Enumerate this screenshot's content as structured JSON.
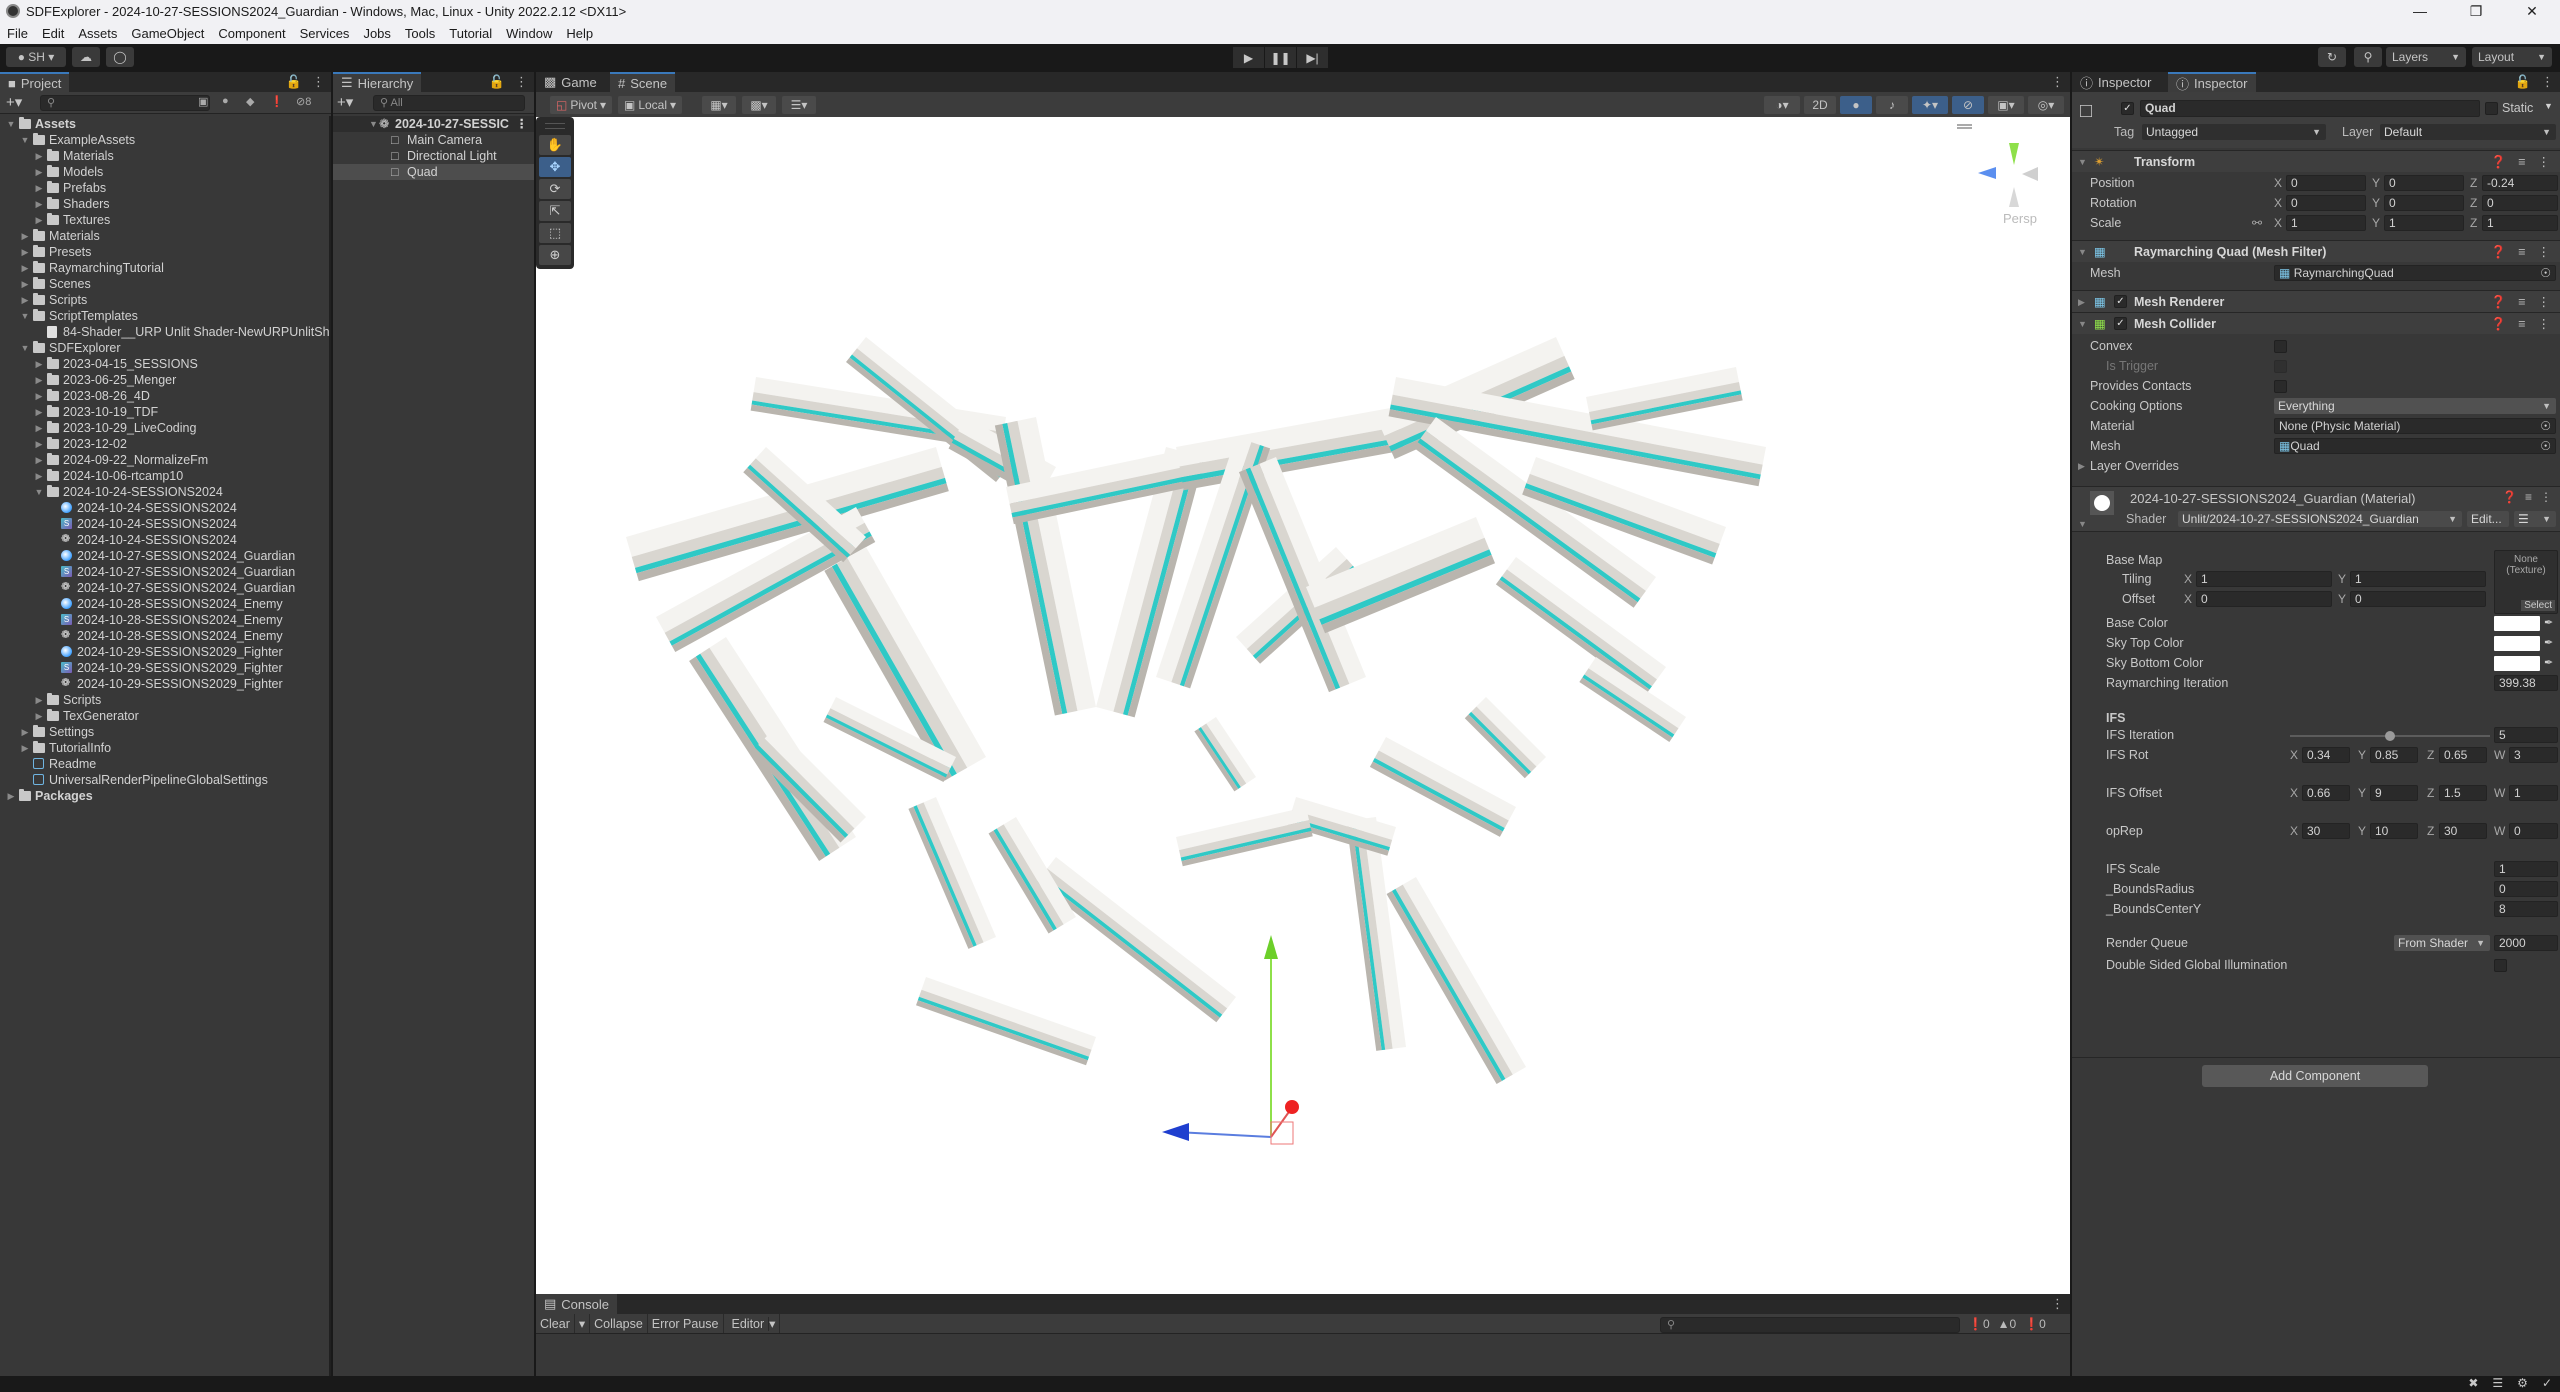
{
  "window": {
    "title": "SDFExplorer - 2024-10-27-SESSIONS2024_Guardian - Windows, Mac, Linux - Unity 2022.2.12 <DX11>",
    "controls": [
      "minimize",
      "maximize",
      "close"
    ]
  },
  "menu": [
    "File",
    "Edit",
    "Assets",
    "GameObject",
    "Component",
    "Services",
    "Jobs",
    "Tools",
    "Tutorial",
    "Window",
    "Help"
  ],
  "toolbar": {
    "account": "SH",
    "layers": "Layers",
    "layout": "Layout"
  },
  "project": {
    "tab": "Project",
    "hidden_count": "8",
    "tree": [
      {
        "label": "Assets",
        "depth": 0,
        "type": "folder-open",
        "expanded": true,
        "bold": true
      },
      {
        "label": "ExampleAssets",
        "depth": 1,
        "type": "folder-open",
        "expanded": true
      },
      {
        "label": "Materials",
        "depth": 2,
        "type": "folder"
      },
      {
        "label": "Models",
        "depth": 2,
        "type": "folder"
      },
      {
        "label": "Prefabs",
        "depth": 2,
        "type": "folder"
      },
      {
        "label": "Shaders",
        "depth": 2,
        "type": "folder"
      },
      {
        "label": "Textures",
        "depth": 2,
        "type": "folder"
      },
      {
        "label": "Materials",
        "depth": 1,
        "type": "folder"
      },
      {
        "label": "Presets",
        "depth": 1,
        "type": "folder"
      },
      {
        "label": "RaymarchingTutorial",
        "depth": 1,
        "type": "folder"
      },
      {
        "label": "Scenes",
        "depth": 1,
        "type": "folder"
      },
      {
        "label": "Scripts",
        "depth": 1,
        "type": "folder"
      },
      {
        "label": "ScriptTemplates",
        "depth": 1,
        "type": "folder-open",
        "expanded": true
      },
      {
        "label": "84-Shader__URP Unlit Shader-NewURPUnlitSh",
        "depth": 2,
        "type": "doc"
      },
      {
        "label": "SDFExplorer",
        "depth": 1,
        "type": "folder-open",
        "expanded": true
      },
      {
        "label": "2023-04-15_SESSIONS",
        "depth": 2,
        "type": "folder"
      },
      {
        "label": "2023-06-25_Menger",
        "depth": 2,
        "type": "folder"
      },
      {
        "label": "2023-08-26_4D",
        "depth": 2,
        "type": "folder"
      },
      {
        "label": "2023-10-19_TDF",
        "depth": 2,
        "type": "folder"
      },
      {
        "label": "2023-10-29_LiveCoding",
        "depth": 2,
        "type": "folder"
      },
      {
        "label": "2023-12-02",
        "depth": 2,
        "type": "folder"
      },
      {
        "label": "2024-09-22_NormalizeFm",
        "depth": 2,
        "type": "folder"
      },
      {
        "label": "2024-10-06-rtcamp10",
        "depth": 2,
        "type": "folder"
      },
      {
        "label": "2024-10-24-SESSIONS2024",
        "depth": 2,
        "type": "folder-open",
        "expanded": true
      },
      {
        "label": "2024-10-24-SESSIONS2024",
        "depth": 3,
        "type": "material"
      },
      {
        "label": "2024-10-24-SESSIONS2024",
        "depth": 3,
        "type": "shader"
      },
      {
        "label": "2024-10-24-SESSIONS2024",
        "depth": 3,
        "type": "scene"
      },
      {
        "label": "2024-10-27-SESSIONS2024_Guardian",
        "depth": 3,
        "type": "material"
      },
      {
        "label": "2024-10-27-SESSIONS2024_Guardian",
        "depth": 3,
        "type": "shader"
      },
      {
        "label": "2024-10-27-SESSIONS2024_Guardian",
        "depth": 3,
        "type": "scene"
      },
      {
        "label": "2024-10-28-SESSIONS2024_Enemy",
        "depth": 3,
        "type": "material"
      },
      {
        "label": "2024-10-28-SESSIONS2024_Enemy",
        "depth": 3,
        "type": "shader"
      },
      {
        "label": "2024-10-28-SESSIONS2024_Enemy",
        "depth": 3,
        "type": "scene"
      },
      {
        "label": "2024-10-29-SESSIONS2029_Fighter",
        "depth": 3,
        "type": "material"
      },
      {
        "label": "2024-10-29-SESSIONS2029_Fighter",
        "depth": 3,
        "type": "shader"
      },
      {
        "label": "2024-10-29-SESSIONS2029_Fighter",
        "depth": 3,
        "type": "scene"
      },
      {
        "label": "Scripts",
        "depth": 2,
        "type": "folder"
      },
      {
        "label": "TexGenerator",
        "depth": 2,
        "type": "folder"
      },
      {
        "label": "Settings",
        "depth": 1,
        "type": "folder"
      },
      {
        "label": "TutorialInfo",
        "depth": 1,
        "type": "folder"
      },
      {
        "label": "Readme",
        "depth": 1,
        "type": "scriptable"
      },
      {
        "label": "UniversalRenderPipelineGlobalSettings",
        "depth": 1,
        "type": "scriptable"
      },
      {
        "label": "Packages",
        "depth": 0,
        "type": "folder",
        "bold": true
      }
    ]
  },
  "hierarchy": {
    "tab": "Hierarchy",
    "search_placeholder": "All",
    "scene": "2024-10-27-SESSIC",
    "items": [
      "Main Camera",
      "Directional Light",
      "Quad"
    ],
    "selected": "Quad"
  },
  "scene_view": {
    "tabs": [
      "Game",
      "Scene"
    ],
    "active_tab": "Scene",
    "pivot": "Pivot",
    "space": "Local",
    "mode_2d": "2D",
    "camera_label": "Persp",
    "tools": [
      "hand",
      "move",
      "rotate",
      "scale",
      "rect",
      "transform"
    ],
    "active_tool": "move",
    "accent_color": "#2fc9c6"
  },
  "console": {
    "tab": "Console",
    "buttons": [
      "Clear",
      "Collapse",
      "Error Pause",
      "Editor"
    ],
    "log_count": "0",
    "warning_count": "0",
    "error_count": "0"
  },
  "inspector": {
    "tabs": [
      "Inspector",
      "Inspector"
    ],
    "object": {
      "name": "Quad",
      "active": true,
      "static_label": "Static",
      "tag_label": "Tag",
      "tag": "Untagged",
      "layer_label": "Layer",
      "layer": "Default"
    },
    "transform": {
      "title": "Transform",
      "position": {
        "label": "Position",
        "x": "0",
        "y": "0",
        "z": "-0.24"
      },
      "rotation": {
        "label": "Rotation",
        "x": "0",
        "y": "0",
        "z": "0"
      },
      "scale": {
        "label": "Scale",
        "x": "1",
        "y": "1",
        "z": "1"
      }
    },
    "mesh_filter": {
      "title": "Raymarching Quad (Mesh Filter)",
      "mesh_label": "Mesh",
      "mesh": "RaymarchingQuad"
    },
    "mesh_renderer": {
      "title": "Mesh Renderer",
      "enabled": true
    },
    "mesh_collider": {
      "title": "Mesh Collider",
      "enabled": true,
      "convex_label": "Convex",
      "is_trigger_label": "Is Trigger",
      "provides_contacts_label": "Provides Contacts",
      "cooking_label": "Cooking Options",
      "cooking": "Everything",
      "material_label": "Material",
      "material": "None (Physic Material)",
      "mesh_label": "Mesh",
      "mesh": "Quad",
      "layer_overrides": "Layer Overrides"
    },
    "material": {
      "title": "2024-10-27-SESSIONS2024_Guardian (Material)",
      "shader_label": "Shader",
      "shader": "Unlit/2024-10-27-SESSIONS2024_Guardian",
      "edit": "Edit...",
      "base_map": "Base Map",
      "texture_slot": "None (Texture)",
      "select": "Select",
      "tiling": {
        "label": "Tiling",
        "x": "1",
        "y": "1"
      },
      "offset": {
        "label": "Offset",
        "x": "0",
        "y": "0"
      },
      "base_color": "Base Color",
      "sky_top": "Sky Top Color",
      "sky_bottom": "Sky Bottom Color",
      "colors": {
        "base": "#ffffff",
        "sky_top": "#ffffff",
        "sky_bottom": "#ffffff"
      },
      "ray_iter": {
        "label": "Raymarching Iteration",
        "value": "399.38"
      },
      "ifs_header": "IFS",
      "ifs_iter": {
        "label": "IFS Iteration",
        "value": "5",
        "slider_fraction": 0.5
      },
      "ifs_rot": {
        "label": "IFS Rot",
        "x": "0.34",
        "y": "0.85",
        "z": "0.65",
        "w": "3"
      },
      "ifs_offset": {
        "label": "IFS Offset",
        "x": "0.66",
        "y": "9",
        "z": "1.5",
        "w": "1"
      },
      "oprep": {
        "label": "opRep",
        "x": "30",
        "y": "10",
        "z": "30",
        "w": "0"
      },
      "ifs_scale": {
        "label": "IFS Scale",
        "value": "1"
      },
      "bounds_radius": {
        "label": "_BoundsRadius",
        "value": "0"
      },
      "bounds_center_y": {
        "label": "_BoundsCenterY",
        "value": "8"
      },
      "render_queue": {
        "label": "Render Queue",
        "mode": "From Shader",
        "value": "2000"
      },
      "double_sided": "Double Sided Global Illumination"
    },
    "add_component": "Add Component"
  }
}
